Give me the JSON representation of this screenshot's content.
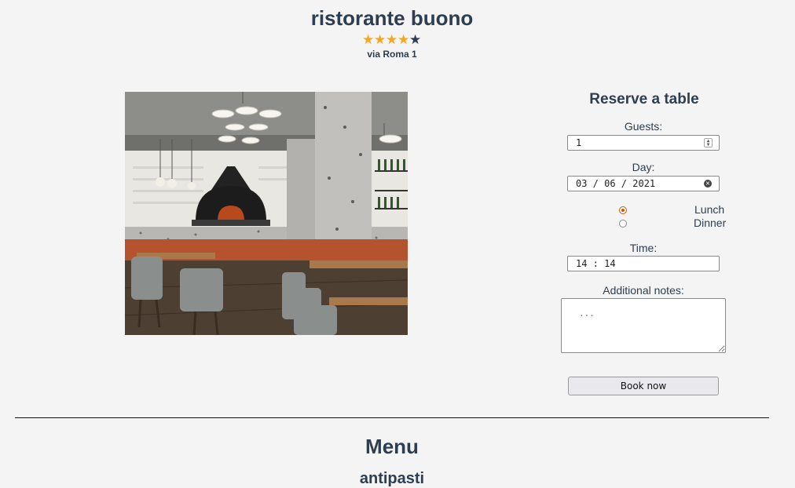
{
  "restaurant": {
    "name": "ristorante buono",
    "rating": 4,
    "rating_max": 5,
    "address": "via Roma 1"
  },
  "reservation": {
    "title": "Reserve a table",
    "guests_label": "Guests:",
    "guests_value": "1",
    "day_label": "Day:",
    "day_value": "03 / 06 / 2021",
    "meal_options": [
      "Lunch",
      "Dinner"
    ],
    "meal_selected": "Lunch",
    "time_label": "Time:",
    "time_value": "14 : 14",
    "notes_label": "Additional notes:",
    "notes_placeholder": "...",
    "book_label": "Book now"
  },
  "menu": {
    "title": "Menu",
    "sections": [
      "antipasti"
    ]
  },
  "colors": {
    "accent": "#d35400",
    "star": "#f5a623",
    "text": "#2c3e50"
  }
}
